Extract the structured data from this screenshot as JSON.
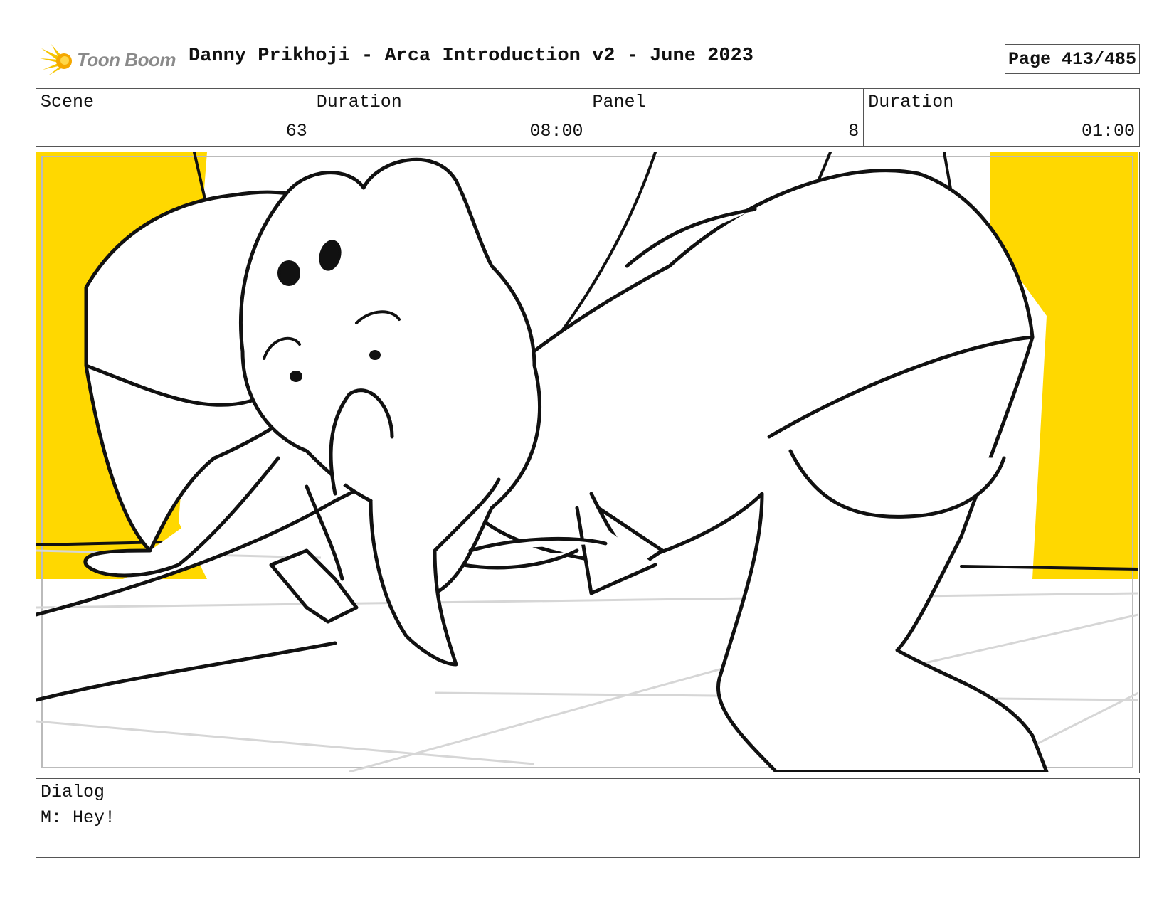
{
  "header": {
    "logo_text": "Toon Boom",
    "title": "Danny Prikhoji - Arca Introduction v2 - June 2023",
    "page": "Page 413/485"
  },
  "info": {
    "scene_label": "Scene",
    "scene_value": "63",
    "scene_duration_label": "Duration",
    "scene_duration_value": "08:00",
    "panel_label": "Panel",
    "panel_value": "8",
    "panel_duration_label": "Duration",
    "panel_duration_value": "01:00"
  },
  "panel_image": {
    "icon": "storyboard-sketch",
    "background_color": "#FFD800",
    "floor_color": "#ffffff",
    "line_color": "#111111"
  },
  "dialog": {
    "label": "Dialog",
    "text": "M: Hey!"
  }
}
